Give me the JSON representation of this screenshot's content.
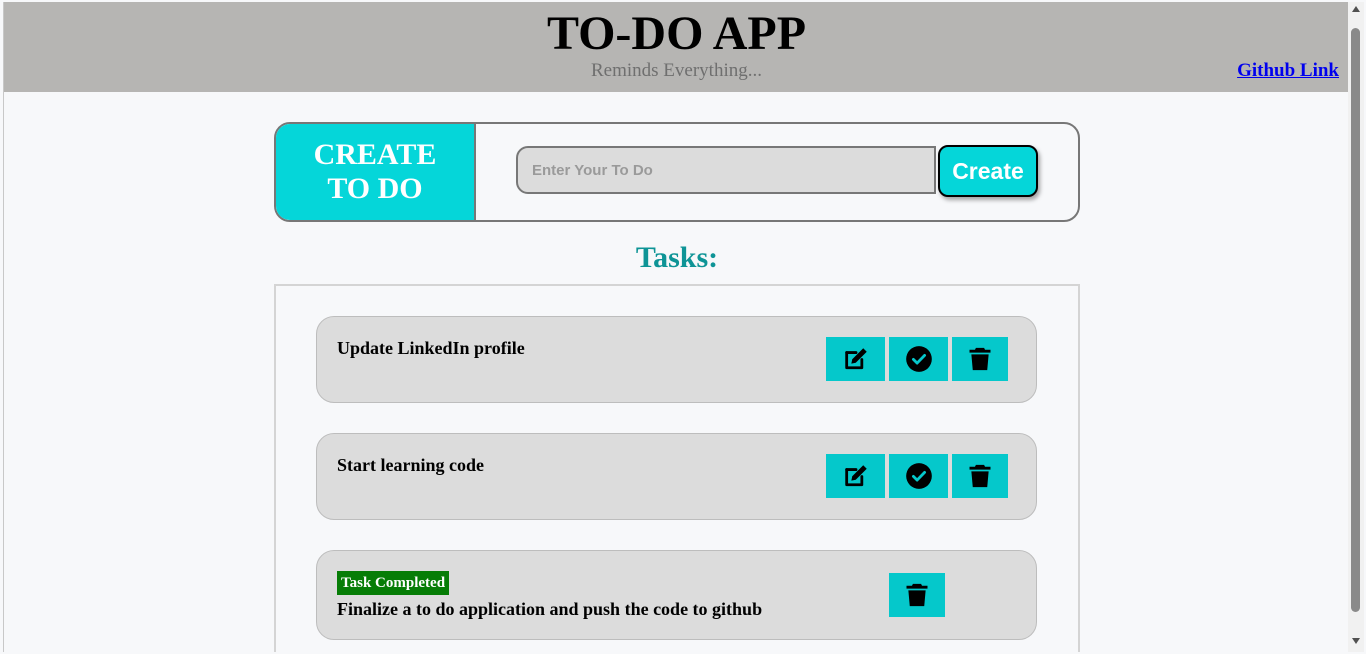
{
  "header": {
    "title": "TO-DO APP",
    "subtitle": "Reminds Everything...",
    "github_link": "Github Link"
  },
  "create": {
    "label_line1": "CREATE",
    "label_line2": "TO DO",
    "input_placeholder": "Enter Your To Do",
    "input_value": "",
    "button_label": "Create"
  },
  "tasks": {
    "heading": "Tasks:",
    "items": [
      {
        "text": "Update LinkedIn profile",
        "completed": false
      },
      {
        "text": "Start learning code",
        "completed": false
      },
      {
        "text": "Finalize a to do application and push the code to github",
        "completed": true,
        "badge": "Task Completed"
      }
    ]
  },
  "icons": {
    "edit": "edit-icon",
    "complete": "check-circle-icon",
    "delete": "trash-icon"
  },
  "colors": {
    "accent": "#05d6d9",
    "button": "#05c8cb",
    "header_bg": "#b6b5b3",
    "heading": "#0e9496",
    "completed_badge": "#067d06"
  }
}
